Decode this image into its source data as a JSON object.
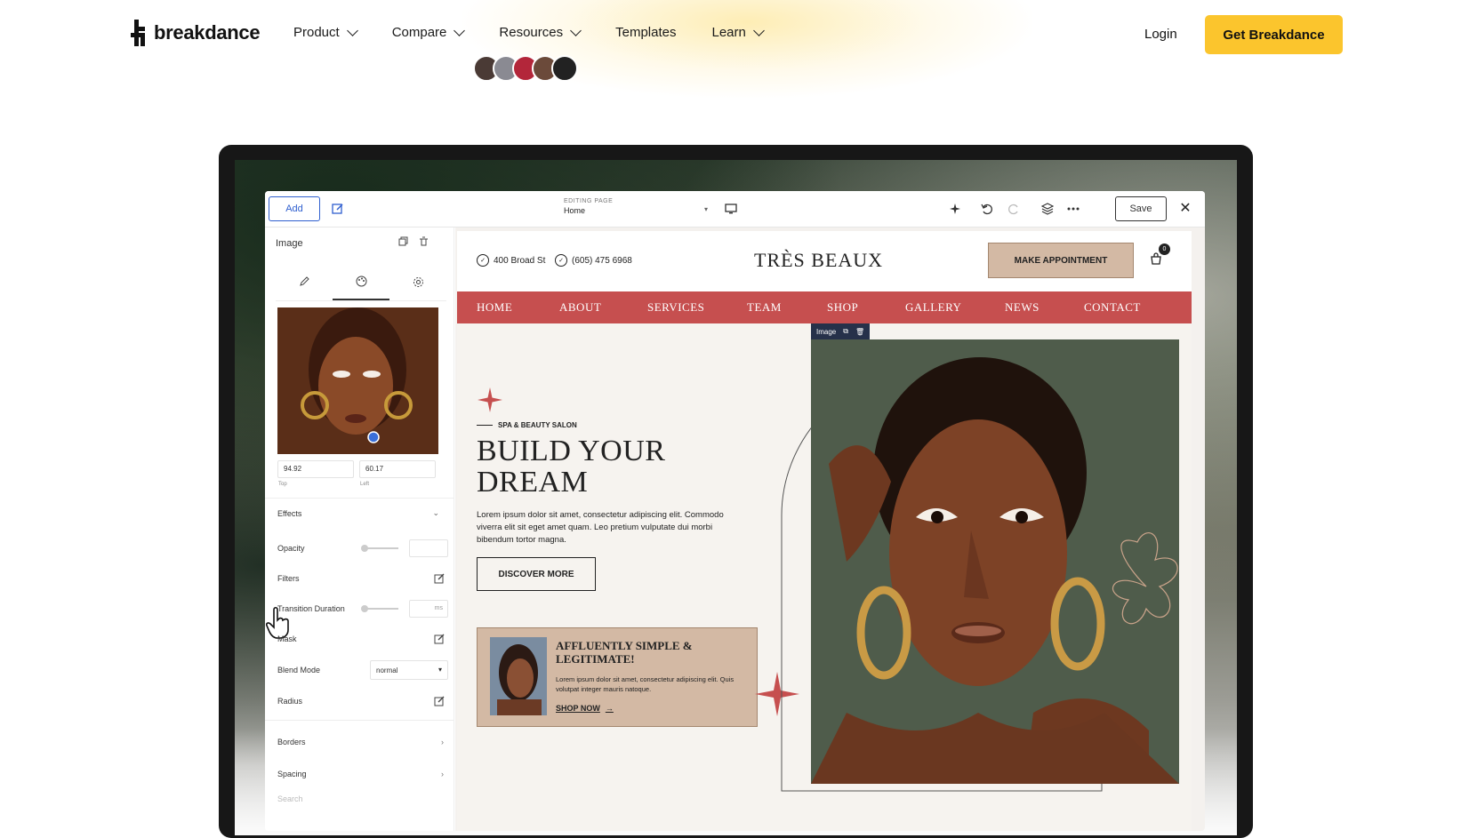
{
  "topnav": {
    "logo_text": "breakdance",
    "items": [
      {
        "label": "Product",
        "has_dropdown": true
      },
      {
        "label": "Compare",
        "has_dropdown": true
      },
      {
        "label": "Resources",
        "has_dropdown": true
      },
      {
        "label": "Templates",
        "has_dropdown": false
      },
      {
        "label": "Learn",
        "has_dropdown": true
      }
    ],
    "login_label": "Login",
    "cta_label": "Get Breakdance",
    "cta_color": "#fbc52d"
  },
  "builder": {
    "toolbar": {
      "add_label": "Add",
      "editing_label": "EDITING PAGE",
      "editing_value": "Home",
      "save_label": "Save"
    },
    "panel": {
      "title": "Image",
      "coords": {
        "top_value": "94.92",
        "top_label": "Top",
        "left_value": "60.17",
        "left_label": "Left"
      },
      "effects_label": "Effects",
      "opacity_label": "Opacity",
      "filters_label": "Filters",
      "transition_label": "Transition Duration",
      "transition_unit": "ms",
      "mask_label": "Mask",
      "blend_label": "Blend Mode",
      "blend_value": "normal",
      "radius_label": "Radius",
      "borders_label": "Borders",
      "spacing_label": "Spacing",
      "search_placeholder": "Search"
    }
  },
  "site": {
    "address": "400 Broad St",
    "phone": "(605) 475 6968",
    "brand": "TRÈS BEAUX",
    "appointment_label": "MAKE APPOINTMENT",
    "cart_count": "0",
    "nav": [
      "HOME",
      "ABOUT",
      "SERVICES",
      "TEAM",
      "SHOP",
      "GALLERY",
      "NEWS",
      "CONTACT"
    ],
    "nav_color": "#c64f4f",
    "tagline": "SPA & BEAUTY SALON",
    "hero_title": "BUILD YOUR DREAM",
    "hero_text": "Lorem ipsum dolor sit amet, consectetur adipiscing elit. Commodo viverra elit sit eget amet quam. Leo pretium vulputate dui morbi bibendum tortor magna.",
    "discover_label": "DISCOVER MORE",
    "card": {
      "title": "AFFLUENTLY SIMPLE & LEGITIMATE!",
      "text": "Lorem ipsum dolor sit amet, consectetur adipiscing elit. Quis volutpat integer mauris natoque.",
      "link": "SHOP NOW"
    },
    "image_badge": "Image"
  }
}
